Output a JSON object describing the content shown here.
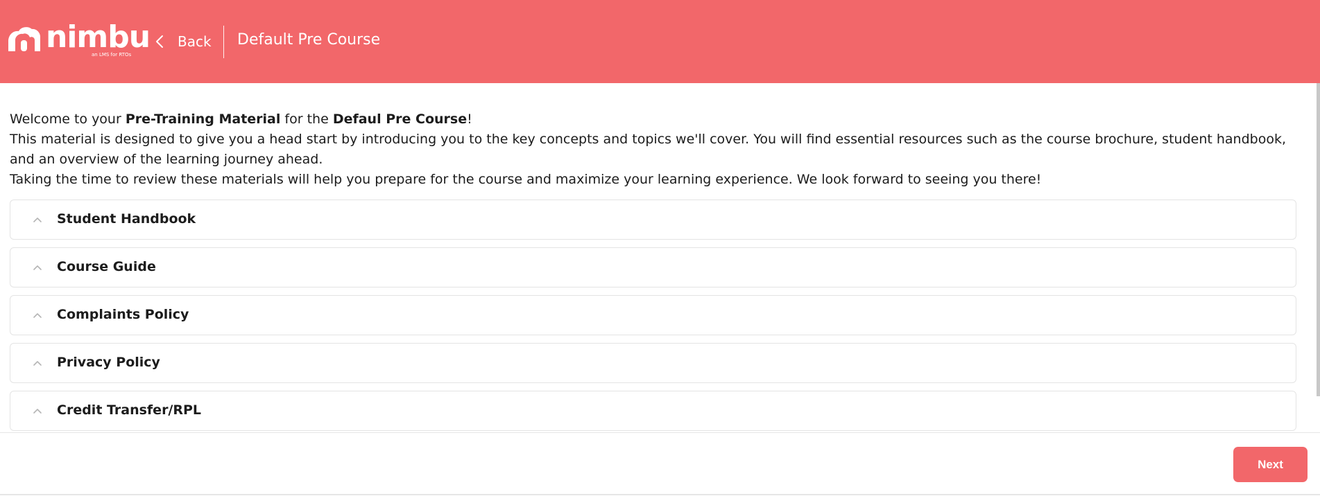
{
  "header": {
    "logo_word": "nimbu",
    "logo_tagline": "an LMS for RTOs",
    "back_label": "Back",
    "course_title": "Default Pre Course",
    "background_color": "#f2676a"
  },
  "intro": {
    "line1_prefix": "Welcome to your ",
    "line1_bold1": "Pre-Training Material",
    "line1_mid": " for the ",
    "line1_bold2": "Defaul Pre Course",
    "line1_suffix": "!",
    "line2": "This material is designed to give you a head start by introducing you to the key concepts and topics we'll cover. You will find essential resources such as the course brochure, student handbook, and an overview of the learning journey ahead.",
    "line3": "Taking the time to review these materials will help you prepare for the course and maximize your learning experience. We look forward to seeing you there!"
  },
  "sections": [
    {
      "label": "Student Handbook",
      "icon": "chevron-up-icon"
    },
    {
      "label": "Course Guide",
      "icon": "chevron-up-icon"
    },
    {
      "label": "Complaints Policy",
      "icon": "chevron-up-icon"
    },
    {
      "label": "Privacy Policy",
      "icon": "chevron-up-icon"
    },
    {
      "label": "Credit Transfer/RPL",
      "icon": "chevron-up-icon"
    }
  ],
  "footer": {
    "next_label": "Next"
  },
  "colors": {
    "brand": "#f2676a",
    "text": "#1c1c1c",
    "border": "#e4e4e4"
  }
}
